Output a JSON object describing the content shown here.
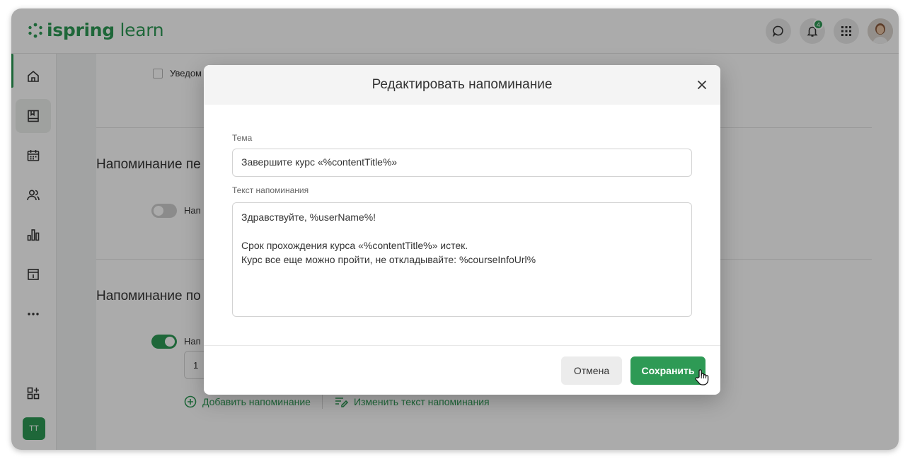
{
  "app": {
    "logo": {
      "brand": "ispring",
      "product": " learn"
    },
    "header": {
      "notification_count": "4"
    },
    "user_initials": "TT"
  },
  "background": {
    "notify_checkbox_label": "Уведом",
    "section1_title": "Напоминание пе",
    "section1_toggle_label": "Нап",
    "section2_title": "Напоминание по",
    "section2_toggle_label": "Нап",
    "interval_value": "1",
    "add_reminder_link": "Добавить напоминание",
    "edit_text_link": "Изменить текст напоминания"
  },
  "modal": {
    "title": "Редактировать напоминание",
    "subject_label": "Тема",
    "subject_value": "Завершите курс «%contentTitle%»",
    "body_label": "Текст напоминания",
    "body_lines": [
      "Здравствуйте, %userName%!",
      "",
      "Срок прохождения курса «%contentTitle%» истек.",
      "Курс все еще можно пройти, не откладывайте: %courseInfoUrl%"
    ],
    "cancel_label": "Отмена",
    "save_label": "Сохранить"
  },
  "colors": {
    "accent": "#2e9a55",
    "overlay": "rgba(0,0,0,0.33)"
  },
  "icons": {
    "sidebar": [
      "home-icon",
      "book-icon",
      "calendar-icon",
      "users-icon",
      "bar-chart-icon",
      "event-icon",
      "more-icon",
      "add-widget-icon"
    ],
    "header": [
      "chat-icon",
      "bell-icon",
      "apps-grid-icon",
      "user-avatar"
    ]
  }
}
